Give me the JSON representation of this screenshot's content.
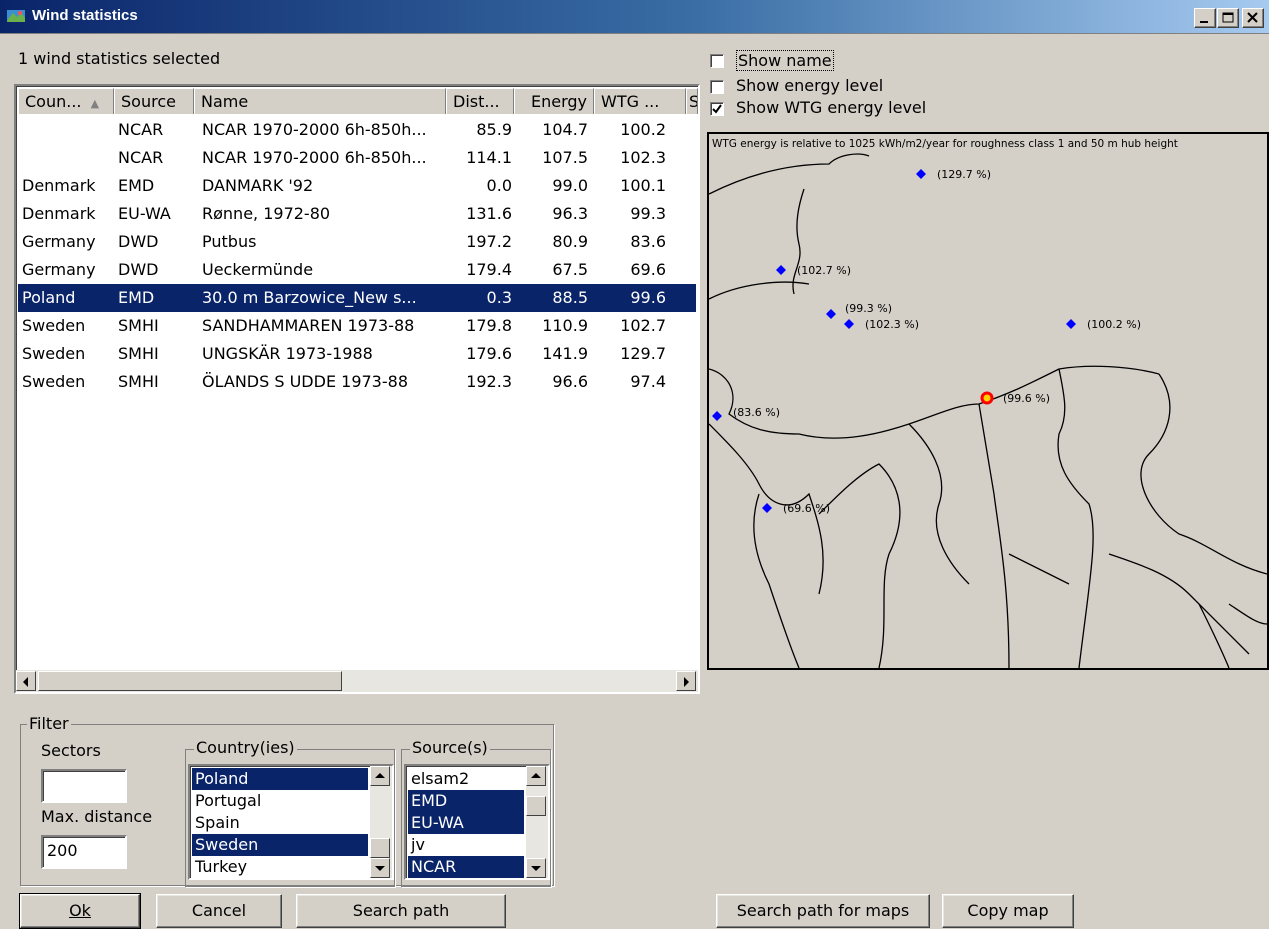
{
  "window": {
    "title": "Wind statistics",
    "minimize_icon": "minimize-icon",
    "maximize_icon": "maximize-icon",
    "close_icon": "close-icon"
  },
  "status_text": "1 wind statistics selected",
  "table": {
    "columns": [
      "Coun...",
      "Source",
      "Name",
      "Dist...",
      "Energy",
      "WTG ...",
      "S"
    ],
    "sort_indicator": "▲",
    "rows": [
      {
        "country": "",
        "source": "NCAR",
        "name": "NCAR 1970-2000 6h-850h...",
        "dist": "85.9",
        "energy": "104.7",
        "wtg": "100.2",
        "selected": false
      },
      {
        "country": "",
        "source": "NCAR",
        "name": "NCAR 1970-2000 6h-850h...",
        "dist": "114.1",
        "energy": "107.5",
        "wtg": "102.3",
        "selected": false
      },
      {
        "country": "Denmark",
        "source": "EMD",
        "name": "DANMARK '92",
        "dist": "0.0",
        "energy": "99.0",
        "wtg": "100.1",
        "selected": false
      },
      {
        "country": "Denmark",
        "source": "EU-WA",
        "name": "Rønne, 1972-80",
        "dist": "131.6",
        "energy": "96.3",
        "wtg": "99.3",
        "selected": false
      },
      {
        "country": "Germany",
        "source": "DWD",
        "name": "Putbus",
        "dist": "197.2",
        "energy": "80.9",
        "wtg": "83.6",
        "selected": false
      },
      {
        "country": "Germany",
        "source": "DWD",
        "name": "Ueckermünde",
        "dist": "179.4",
        "energy": "67.5",
        "wtg": "69.6",
        "selected": false
      },
      {
        "country": "Poland",
        "source": "EMD",
        "name": "30.0 m Barzowice_New s...",
        "dist": "0.3",
        "energy": "88.5",
        "wtg": "99.6",
        "selected": true
      },
      {
        "country": "Sweden",
        "source": "SMHI",
        "name": "SANDHAMMAREN 1973-88",
        "dist": "179.8",
        "energy": "110.9",
        "wtg": "102.7",
        "selected": false
      },
      {
        "country": "Sweden",
        "source": "SMHI",
        "name": "UNGSKÄR 1973-1988",
        "dist": "179.6",
        "energy": "141.9",
        "wtg": "129.7",
        "selected": false
      },
      {
        "country": "Sweden",
        "source": "SMHI",
        "name": "ÖLANDS S UDDE 1973-88",
        "dist": "192.3",
        "energy": "96.6",
        "wtg": "97.4",
        "selected": false
      }
    ]
  },
  "filter": {
    "title": "Filter",
    "sectors_label": "Sectors",
    "sectors_value": "",
    "max_distance_label": "Max. distance",
    "max_distance_value": "200",
    "countries_title": "Country(ies)",
    "countries": [
      {
        "label": "Poland",
        "selected": true
      },
      {
        "label": "Portugal",
        "selected": false
      },
      {
        "label": "Spain",
        "selected": false
      },
      {
        "label": "Sweden",
        "selected": true
      },
      {
        "label": "Turkey",
        "selected": false
      }
    ],
    "sources_title": "Source(s)",
    "sources": [
      {
        "label": "elsam2",
        "selected": false
      },
      {
        "label": "EMD",
        "selected": true
      },
      {
        "label": "EU-WA",
        "selected": true
      },
      {
        "label": "jv",
        "selected": false
      },
      {
        "label": "NCAR",
        "selected": true
      }
    ]
  },
  "buttons": {
    "ok": "Ok",
    "cancel": "Cancel",
    "search_path": "Search path",
    "search_path_maps": "Search path for maps",
    "copy_map": "Copy map"
  },
  "options": {
    "show_name": {
      "label": "Show name",
      "checked": false
    },
    "show_energy_level": {
      "label": "Show energy level",
      "checked": false
    },
    "show_wtg_energy_level": {
      "label": "Show WTG energy level",
      "checked": true
    }
  },
  "map": {
    "note": "WTG energy is relative to 1025 kWh/m2/year for roughness class 1 and 50 m hub height",
    "markers": [
      "(129.7 %)",
      "(102.7 %)",
      "(99.3 %)",
      "(102.3 %)",
      "(100.2 %)",
      "(99.6 %)",
      "(83.6 %)",
      "(69.6 %)"
    ],
    "marker_color": "#0000ff",
    "selected_marker_color": "#ff0000"
  },
  "colors": {
    "selection": "#0a246a",
    "dialog_bg": "#d4d0c8"
  }
}
